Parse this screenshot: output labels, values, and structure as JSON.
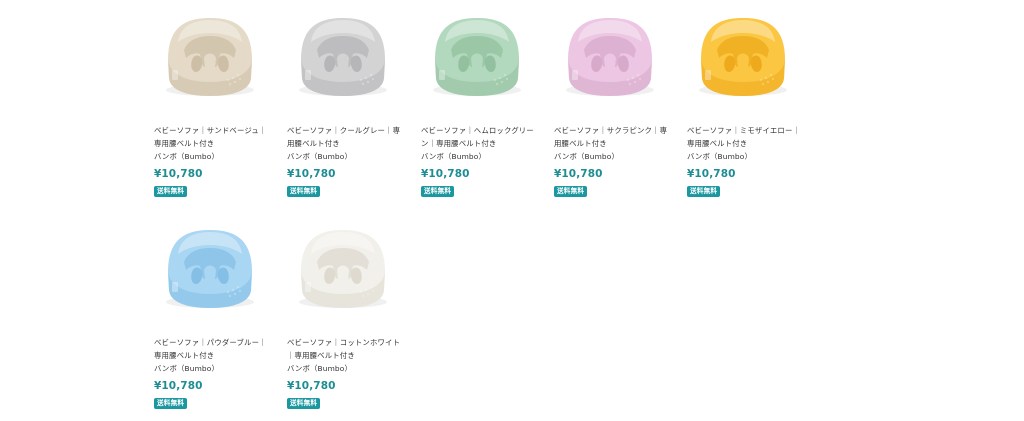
{
  "products": [
    {
      "title": "ベビーソファ｜サンドベージュ｜専用腰ベルト付き",
      "brand": "バンボ（Bumbo）",
      "price": "¥10,780",
      "badge": "送料無料",
      "color": "#e4dac7",
      "shade": "#cdbfa6"
    },
    {
      "title": "ベビーソファ｜クールグレー｜専用腰ベルト付き",
      "brand": "バンボ（Bumbo）",
      "price": "¥10,780",
      "badge": "送料無料",
      "color": "#d3d3d4",
      "shade": "#b6b6b8"
    },
    {
      "title": "ベビーソファ｜ヘムロックグリーン｜専用腰ベルト付き",
      "brand": "バンボ（Bumbo）",
      "price": "¥10,780",
      "badge": "送料無料",
      "color": "#b2d8bd",
      "shade": "#93c19f"
    },
    {
      "title": "ベビーソファ｜サクラピンク｜専用腰ベルト付き",
      "brand": "バンボ（Bumbo）",
      "price": "¥10,780",
      "badge": "送料無料",
      "color": "#ecc6e2",
      "shade": "#d7a9cb"
    },
    {
      "title": "ベビーソファ｜ミモザイエロー｜専用腰ベルト付き",
      "brand": "バンボ（Bumbo）",
      "price": "¥10,780",
      "badge": "送料無料",
      "color": "#fbc642",
      "shade": "#eeaa1c"
    },
    {
      "title": "ベビーソファ｜パウダーブルー｜専用腰ベルト付き",
      "brand": "バンボ（Bumbo）",
      "price": "¥10,780",
      "badge": "送料無料",
      "color": "#a9d6f2",
      "shade": "#85bfe5"
    },
    {
      "title": "ベビーソファ｜コットンホワイト｜専用腰ベルト付き",
      "brand": "バンボ（Bumbo）",
      "price": "¥10,780",
      "badge": "送料無料",
      "color": "#f2f0ea",
      "shade": "#dedad0"
    }
  ],
  "accent": "#1b97a0"
}
